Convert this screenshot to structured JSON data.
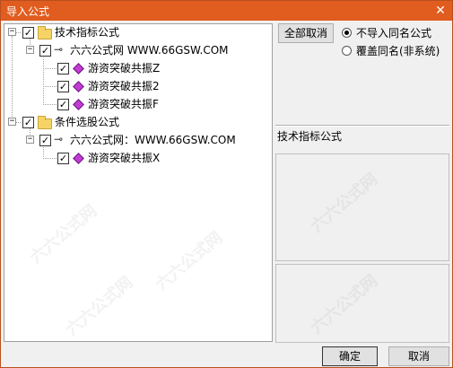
{
  "window": {
    "title": "导入公式",
    "close_glyph": "✕"
  },
  "tree": {
    "nodes": [
      {
        "id": "tech",
        "label": "技术指标公式",
        "checked": true,
        "expander": "−",
        "icon": "folder-icon"
      },
      {
        "id": "tech-site",
        "label": "六六公式网 WWW.66GSW.COM",
        "checked": true,
        "expander": "−",
        "icon": "key-icon"
      },
      {
        "id": "tech-z",
        "label": "游资突破共振Z",
        "checked": true,
        "icon": "formula-gem-icon"
      },
      {
        "id": "tech-2",
        "label": "游资突破共振2",
        "checked": true,
        "icon": "formula-gem-icon"
      },
      {
        "id": "tech-f",
        "label": "游资突破共振F",
        "checked": true,
        "icon": "formula-gem-icon"
      },
      {
        "id": "cond",
        "label": "条件选股公式",
        "checked": true,
        "expander": "−",
        "icon": "folder-icon"
      },
      {
        "id": "cond-site",
        "label": "六六公式网：WWW.66GSW.COM",
        "checked": true,
        "expander": "−",
        "icon": "key-icon"
      },
      {
        "id": "cond-x",
        "label": "游资突破共振X",
        "checked": true,
        "icon": "formula-gem-icon"
      }
    ]
  },
  "controls": {
    "cancel_all_label": "全部取消",
    "radio_no_import": "不导入同名公式",
    "radio_overwrite": "覆盖同名(非系统)",
    "selected_radio": "no_import",
    "category_label": "技术指标公式"
  },
  "buttons": {
    "ok": "确定",
    "cancel": "取消"
  },
  "watermark_text": "六六公式网"
}
